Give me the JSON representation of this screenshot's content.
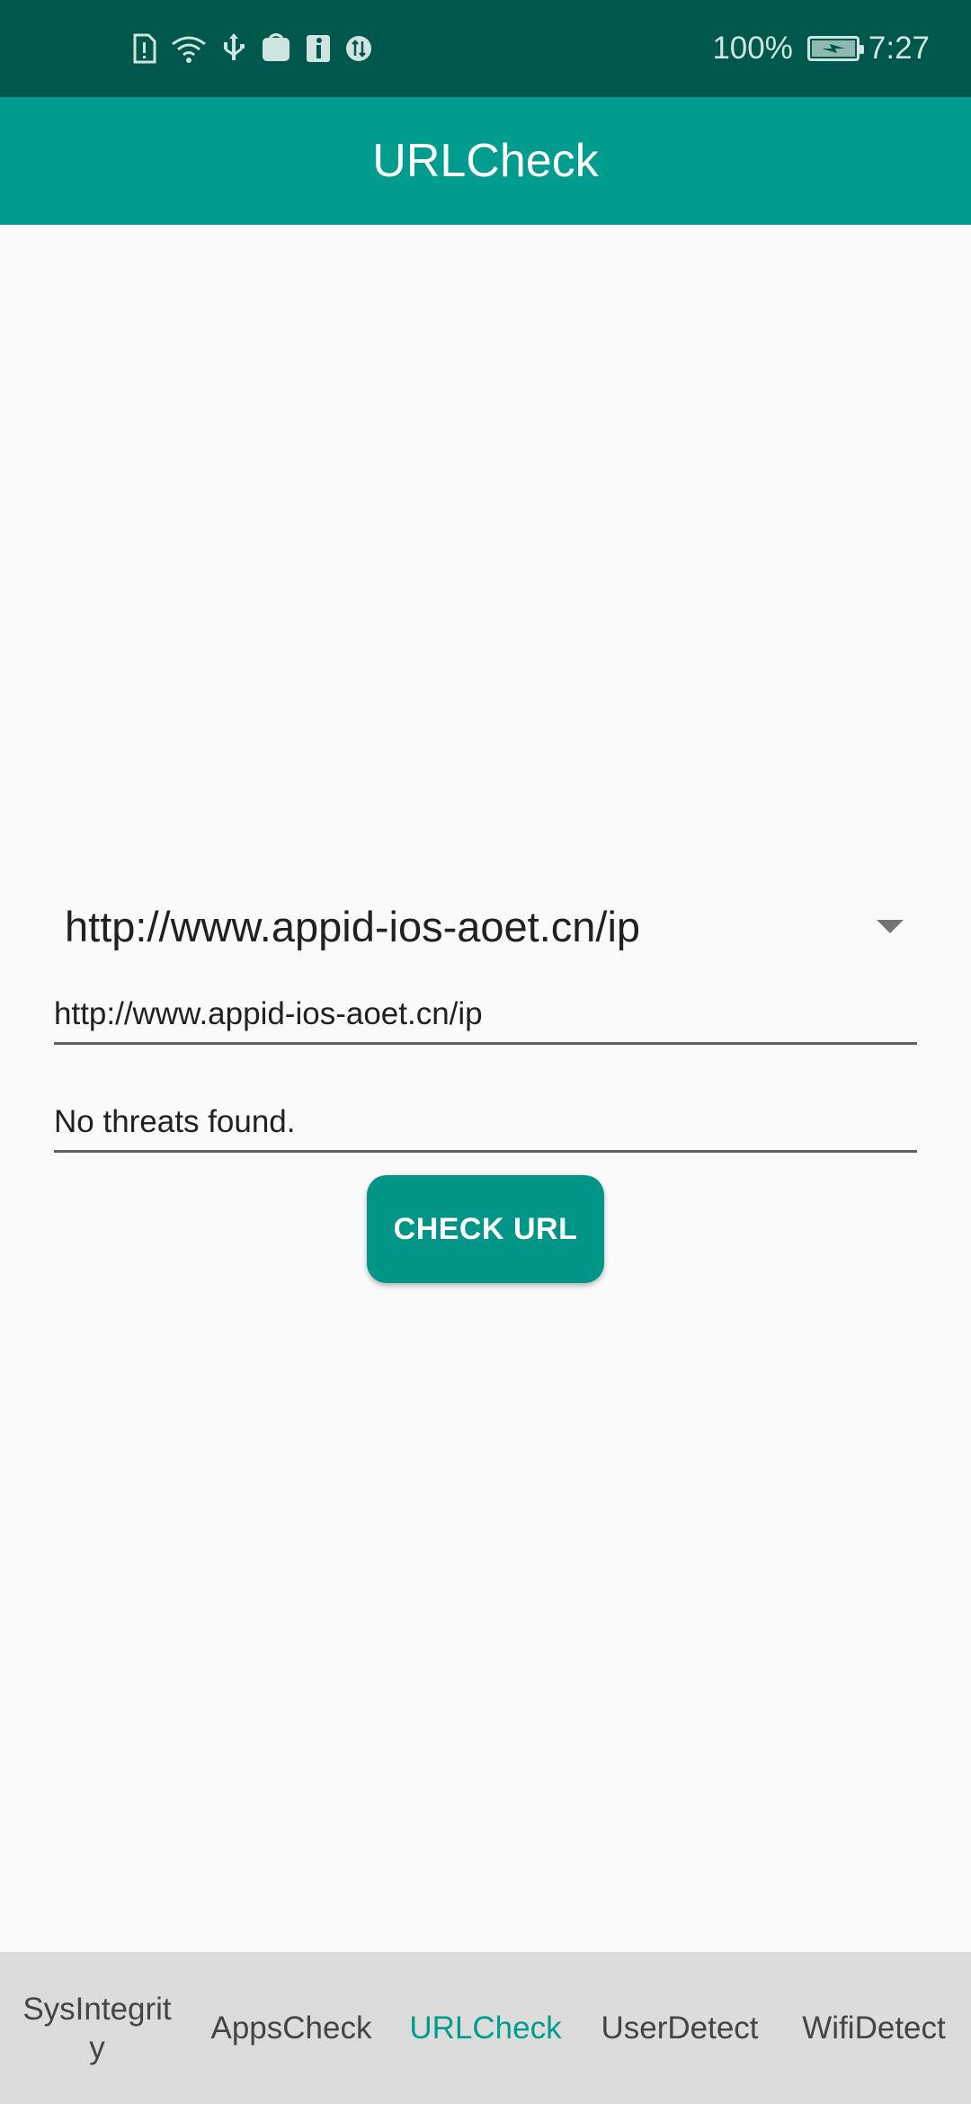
{
  "status_bar": {
    "icons": [
      "sim-alert-icon",
      "wifi-icon",
      "usb-icon",
      "huawei-app-icon",
      "info-icon",
      "data-transfer-icon"
    ],
    "battery": "100%",
    "battery_level": 1.0,
    "time": "7:27"
  },
  "app_bar": {
    "title": "URLCheck"
  },
  "content": {
    "spinner_value": "http://www.appid-ios-aoet.cn/ip",
    "url_field_value": "http://www.appid-ios-aoet.cn/ip",
    "result_text": "No threats found.",
    "check_button_label": "CHECK URL"
  },
  "bottom_nav": {
    "tabs": [
      {
        "label": "SysIntegrit y",
        "line1": "SysIntegrit",
        "line2": "y",
        "active": false
      },
      {
        "label": "AppsCheck",
        "active": false
      },
      {
        "label": "URLCheck",
        "active": true
      },
      {
        "label": "UserDetect",
        "active": false
      },
      {
        "label": "WifiDetect",
        "active": false
      }
    ]
  },
  "colors": {
    "status_bar": "#00574b",
    "app_bar": "#009d8e",
    "button": "#009587",
    "active_tab": "#009d8e",
    "nav_background": "#dcdcdc"
  }
}
